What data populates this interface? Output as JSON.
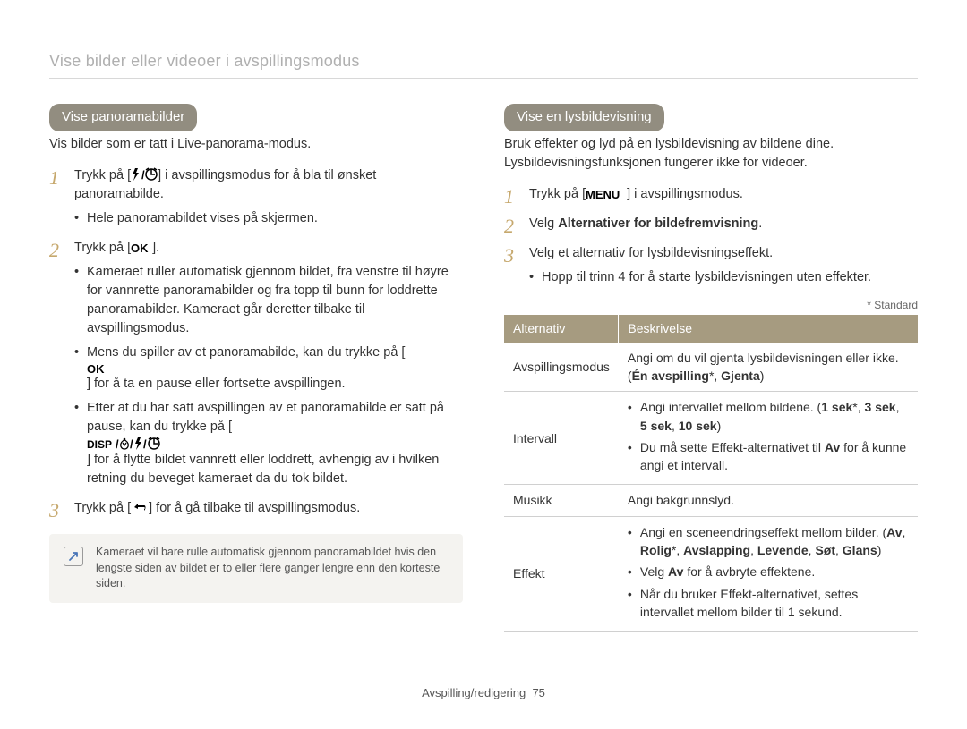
{
  "breadcrumb": "Vise bilder eller videoer i avspillingsmodus",
  "left": {
    "pill": "Vise panoramabilder",
    "subtext": "Vis bilder som er tatt i Live-panorama-modus.",
    "step1_a": "Trykk på [",
    "step1_b": "] i avspillingsmodus for å bla til ønsket panoramabilde.",
    "step1_sub1": "Hele panoramabildet vises på skjermen.",
    "step2_a": "Trykk på [",
    "step2_b": "].",
    "step2_sub1": "Kameraet ruller automatisk gjennom bildet, fra venstre til høyre for vannrette panoramabilder og fra topp til bunn for loddrette panoramabilder. Kameraet går deretter tilbake til avspillingsmodus.",
    "step2_sub2_a": "Mens du spiller av et panoramabilde, kan du trykke på [",
    "step2_sub2_b": "] for å ta en pause eller fortsette avspillingen.",
    "step2_sub3_a": "Etter at du har satt avspillingen av et panoramabilde er satt på pause, kan du trykke på [",
    "step2_sub3_b": "] for å flytte bildet vannrett eller loddrett, avhengig av i hvilken retning du beveget kameraet da du tok bildet.",
    "step3_a": "Trykk på [",
    "step3_b": "] for å gå tilbake til avspillingsmodus.",
    "note": "Kameraet vil bare rulle automatisk gjennom panoramabildet hvis den lengste siden av bildet er to eller flere ganger lengre enn den korteste siden."
  },
  "right": {
    "pill": "Vise en lysbildevisning",
    "subtext": "Bruk effekter og lyd på en lysbildevisning av bildene dine. Lysbildevisningsfunksjonen fungerer ikke for videoer.",
    "step1_a": "Trykk på [",
    "step1_b": "] i avspillingsmodus.",
    "step2_a": "Velg ",
    "step2_bold": "Alternativer for bildefremvisning",
    "step2_b": ".",
    "step3": "Velg et alternativ for lysbildevisningseffekt.",
    "step3_sub1": "Hopp til trinn 4 for å starte lysbildevisningen uten effekter.",
    "std_note": "* Standard",
    "th0": "Alternativ",
    "th1": "Beskrivelse",
    "row0_lbl": "Avspillingsmodus",
    "row0_desc_a": "Angi om du vil gjenta lysbildevisningen eller ikke. (",
    "row0_desc_b": "Én avspilling",
    "row0_desc_c": "*, ",
    "row0_desc_d": "Gjenta",
    "row0_desc_e": ")",
    "row1_lbl": "Intervall",
    "row1_li1_a": "Angi intervallet mellom bildene. (",
    "row1_li1_b": "1 sek",
    "row1_li1_c": "*, ",
    "row1_li1_d": "3 sek",
    "row1_li1_e": ", ",
    "row1_li1_f": "5 sek",
    "row1_li1_g": ", ",
    "row1_li1_h": "10 sek",
    "row1_li1_i": ")",
    "row1_li2_a": "Du må sette Effekt-alternativet til ",
    "row1_li2_b": "Av",
    "row1_li2_c": " for å kunne angi et intervall.",
    "row2_lbl": "Musikk",
    "row2_desc": "Angi bakgrunnslyd.",
    "row3_lbl": "Effekt",
    "row3_li1_a": "Angi en sceneendringseffekt mellom bilder. (",
    "row3_li1_b": "Av",
    "row3_li1_c": ", ",
    "row3_li1_d": "Rolig",
    "row3_li1_e": "*, ",
    "row3_li1_f": "Avslapping",
    "row3_li1_g": ", ",
    "row3_li1_h": "Levende",
    "row3_li1_i": ", ",
    "row3_li1_j": "Søt",
    "row3_li1_k": ", ",
    "row3_li1_l": "Glans",
    "row3_li1_m": ")",
    "row3_li2_a": "Velg ",
    "row3_li2_b": "Av",
    "row3_li2_c": " for å avbryte effektene.",
    "row3_li3": "Når du bruker Effekt-alternativet, settes intervallet mellom bilder til 1 sekund."
  },
  "footer_a": "Avspilling/redigering",
  "footer_b": "75"
}
